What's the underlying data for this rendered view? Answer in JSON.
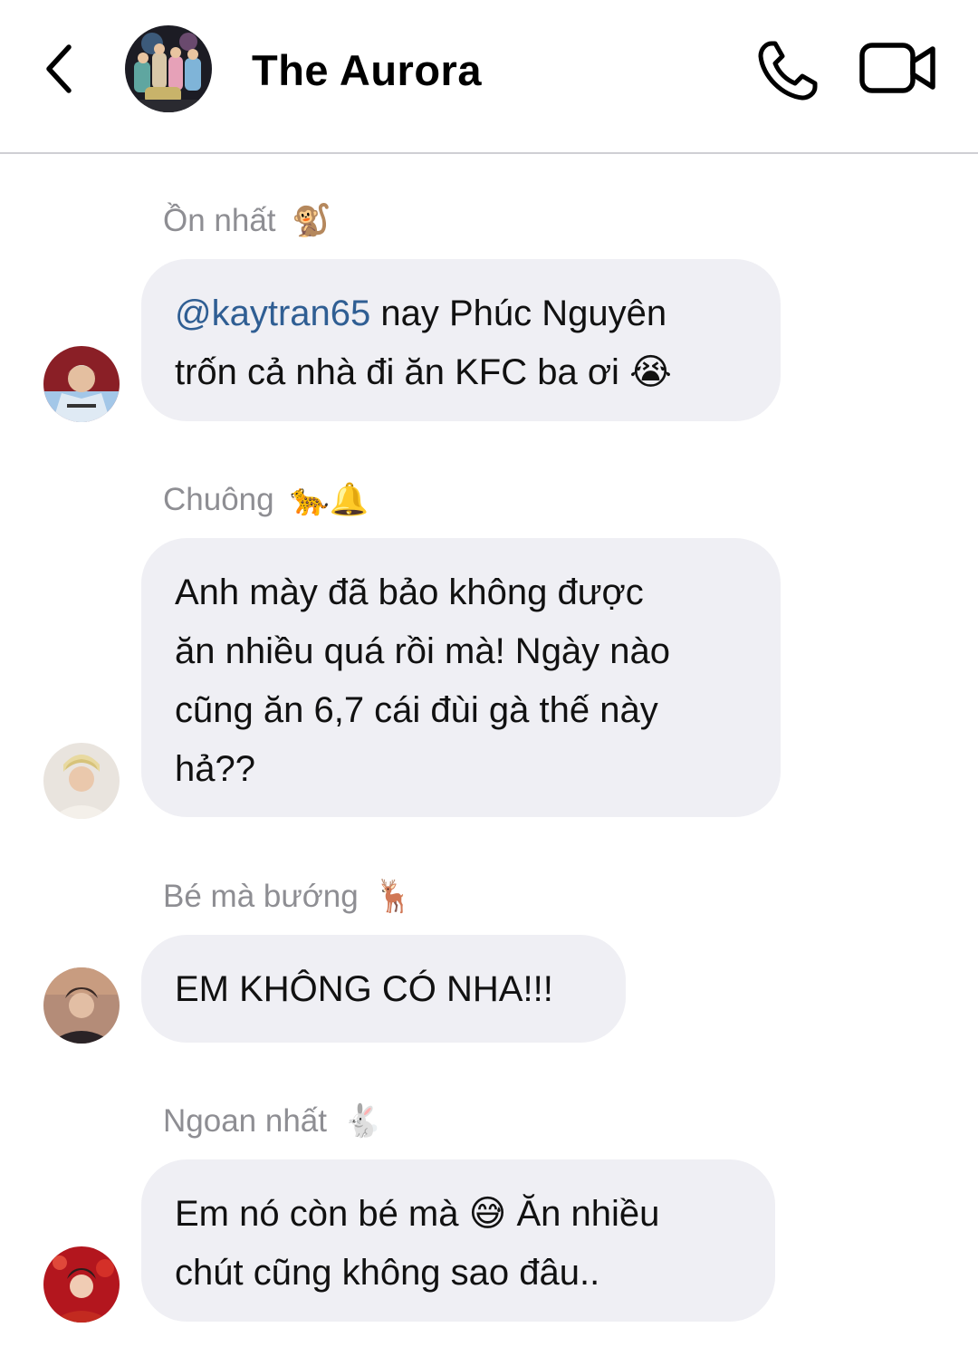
{
  "header": {
    "title": "The Aurora",
    "back_icon": "chevron-left-icon",
    "call_icon": "phone-icon",
    "video_icon": "video-camera-icon"
  },
  "messages": [
    {
      "sender": "Ồn nhất",
      "sender_emoji": "🐒",
      "mention": "@kaytran65",
      "line1_rest": " nay Phúc Nguyên",
      "line2": "trốn cả nhà đi ăn KFC ba ơi",
      "line2_emoji": "😭"
    },
    {
      "sender": "Chuông",
      "sender_emoji": "🐆🔔",
      "lines": [
        "Anh mày đã bảo không được",
        "ăn nhiều quá rồi mà! Ngày nào",
        "cũng ăn 6,7 cái đùi gà thế này",
        "hả??"
      ]
    },
    {
      "sender": "Bé mà bướng",
      "sender_emoji": "🦌",
      "lines": [
        "EM KHÔNG CÓ NHA!!!"
      ]
    },
    {
      "sender": "Ngoan nhất",
      "sender_emoji": "🐇",
      "line1_start": "Em nó còn bé mà",
      "line1_emoji": "😅",
      "line1_end": "Ăn nhiều",
      "line2": "chút cũng không sao đâu.."
    }
  ],
  "colors": {
    "bubble": "#efeff4",
    "sender_name": "#8e8e93",
    "mention": "#2f5e93",
    "divider": "#cfcfd4"
  }
}
